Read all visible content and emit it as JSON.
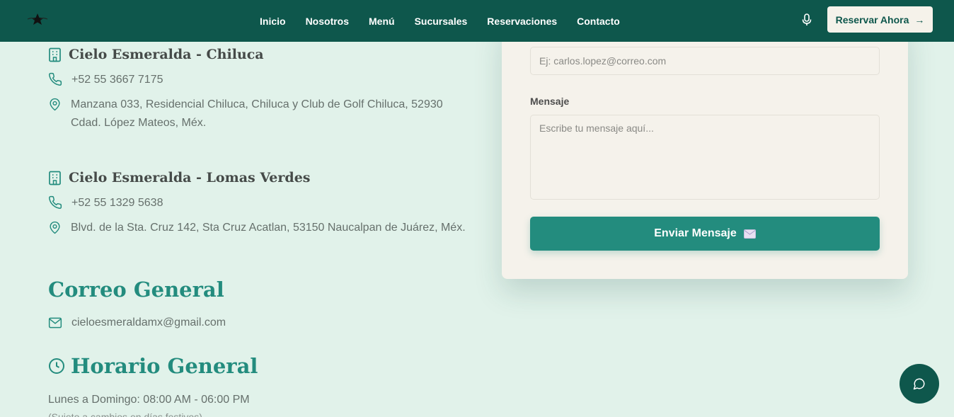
{
  "header": {
    "nav": [
      "Inicio",
      "Nosotros",
      "Menú",
      "Sucursales",
      "Reservaciones",
      "Contacto"
    ],
    "reserve_label": "Reservar Ahora",
    "reserve_arrow": "→"
  },
  "branches": [
    {
      "name": "Cielo Esmeralda - Chiluca",
      "phone": "+52 55 3667 7175",
      "address_line1": "Manzana 033, Residencial Chiluca, Chiluca y Club de Golf Chiluca, 52930",
      "address_line2": "Cdad. López Mateos, Méx."
    },
    {
      "name": "Cielo Esmeralda - Lomas Verdes",
      "phone": "+52 55 1329 5638",
      "address_line1": "Blvd. de la Sta. Cruz 142, Sta Cruz Acatlan, 53150 Naucalpan de Juárez, Méx."
    }
  ],
  "email_section": {
    "title": "Correo General",
    "email": "cieloesmeraldamx@gmail.com"
  },
  "hours_section": {
    "title": "Horario General",
    "line1": "Lunes a Domingo: 08:00 AM - 06:00 PM",
    "line2": "(Sujeto a cambios en días festivos)"
  },
  "form": {
    "email_placeholder": "Ej: carlos.lopez@correo.com",
    "message_label": "Mensaje",
    "message_placeholder": "Escribe tu mensaje aquí...",
    "send_label": "Enviar Mensaje"
  },
  "colors": {
    "header_bg": "#0e574c",
    "page_bg": "#e1f2ea",
    "accent": "#238c7e",
    "card_bg": "#f5f2eb"
  }
}
